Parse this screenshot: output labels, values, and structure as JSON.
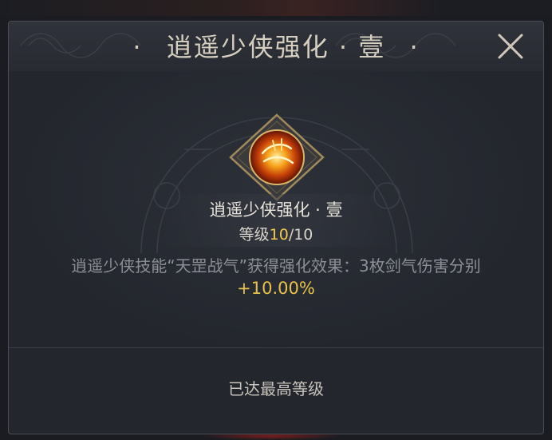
{
  "dialog": {
    "title_left_dot": "·",
    "title": "逍遥少侠强化 · 壹",
    "title_right_dot": "·"
  },
  "item": {
    "name": "逍遥少侠强化 · 壹",
    "level_label": "等级",
    "level_current": "10",
    "level_sep_max": "/10"
  },
  "description": {
    "text": "逍遥少侠技能“天罡战气”获得强化效果：3枚剑气伤害分别",
    "value": "+10.00%"
  },
  "status": {
    "text": "已达最高等级"
  },
  "icons": {
    "close": "close-icon",
    "skill": "flame-sword-skill-icon"
  },
  "colors": {
    "accent_gold": "#f2c94c",
    "value_gold": "#e9c24a",
    "text_muted": "#8c8f96",
    "panel_bg": "#23262d"
  }
}
